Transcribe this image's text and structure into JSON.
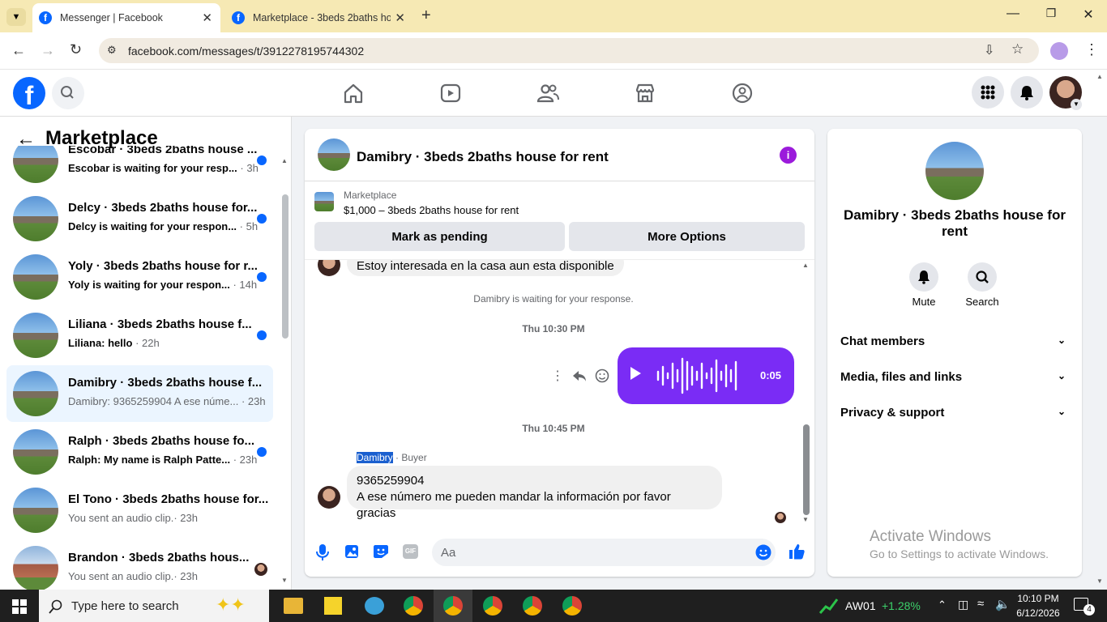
{
  "browser": {
    "tabs": [
      {
        "title": "Messenger | Facebook",
        "active": true
      },
      {
        "title": "Marketplace - 3beds 2baths ho",
        "active": false
      }
    ],
    "url": "facebook.com/messages/t/3912278195744302"
  },
  "sidebar": {
    "title": "Marketplace",
    "conversations": [
      {
        "name": "Escobar · 3beds 2baths house ...",
        "preview": "Escobar is waiting for your resp...",
        "time": "· 3h",
        "unread": true
      },
      {
        "name": "Delcy · 3beds 2baths house for...",
        "preview": "Delcy is waiting for your respon...",
        "time": "· 5h",
        "unread": true
      },
      {
        "name": "Yoly · 3beds 2baths house for r...",
        "preview": "Yoly is waiting for your respon...",
        "time": "· 14h",
        "unread": true
      },
      {
        "name": "Liliana · 3beds 2baths house f...",
        "preview": "Liliana: hello",
        "time": "· 22h",
        "unread": true
      },
      {
        "name": "Damibry · 3beds 2baths house f...",
        "preview": "Damibry: 9365259904 A ese núme...",
        "time": "· 23h",
        "unread": false,
        "selected": true
      },
      {
        "name": "Ralph · 3beds 2baths house fo...",
        "preview": "Ralph: My name is Ralph Patte...",
        "time": "· 23h",
        "unread": true
      },
      {
        "name": "El Tono · 3beds 2baths house for...",
        "preview": "You sent an audio clip.",
        "time": "· 23h",
        "unread": false
      },
      {
        "name": "Brandon · 3beds 2baths hous...",
        "preview": "You sent an audio clip.",
        "time": "· 23h",
        "unread": false
      }
    ]
  },
  "chat": {
    "title": "Damibry · 3beds 2baths house for rent",
    "listing_source": "Marketplace",
    "listing_title": "$1,000 – 3beds 2baths house for rent",
    "mark_pending_label": "Mark as pending",
    "more_options_label": "More Options",
    "messages": {
      "top_partial": "Estoy interesada en la casa aun esta disponible",
      "waiting_notice": "Damibry is waiting for your response.",
      "time1": "Thu 10:30 PM",
      "audio_duration": "0:05",
      "time2": "Thu 10:45 PM",
      "sender_name": "Damibry",
      "sender_role": "· Buyer",
      "last_line1": "9365259904",
      "last_line2": "A ese número me pueden mandar la información por favor gracias"
    },
    "composer_placeholder": "Aa"
  },
  "info": {
    "name": "Damibry · 3beds 2baths house for rent",
    "mute_label": "Mute",
    "search_label": "Search",
    "sections": [
      "Chat members",
      "Media, files and links",
      "Privacy & support"
    ],
    "watermark_title": "Activate Windows",
    "watermark_sub": "Go to Settings to activate Windows."
  },
  "taskbar": {
    "search_placeholder": "Type here to search",
    "stock_name": "AW01",
    "stock_change": "+1.28%",
    "time": "10:10 PM",
    "date": "6/12/2026",
    "notifications": "4"
  },
  "colors": {
    "fb_blue": "#0866ff",
    "audio_purple": "#7a2cf5",
    "tab_bar": "#f6e9b4"
  }
}
